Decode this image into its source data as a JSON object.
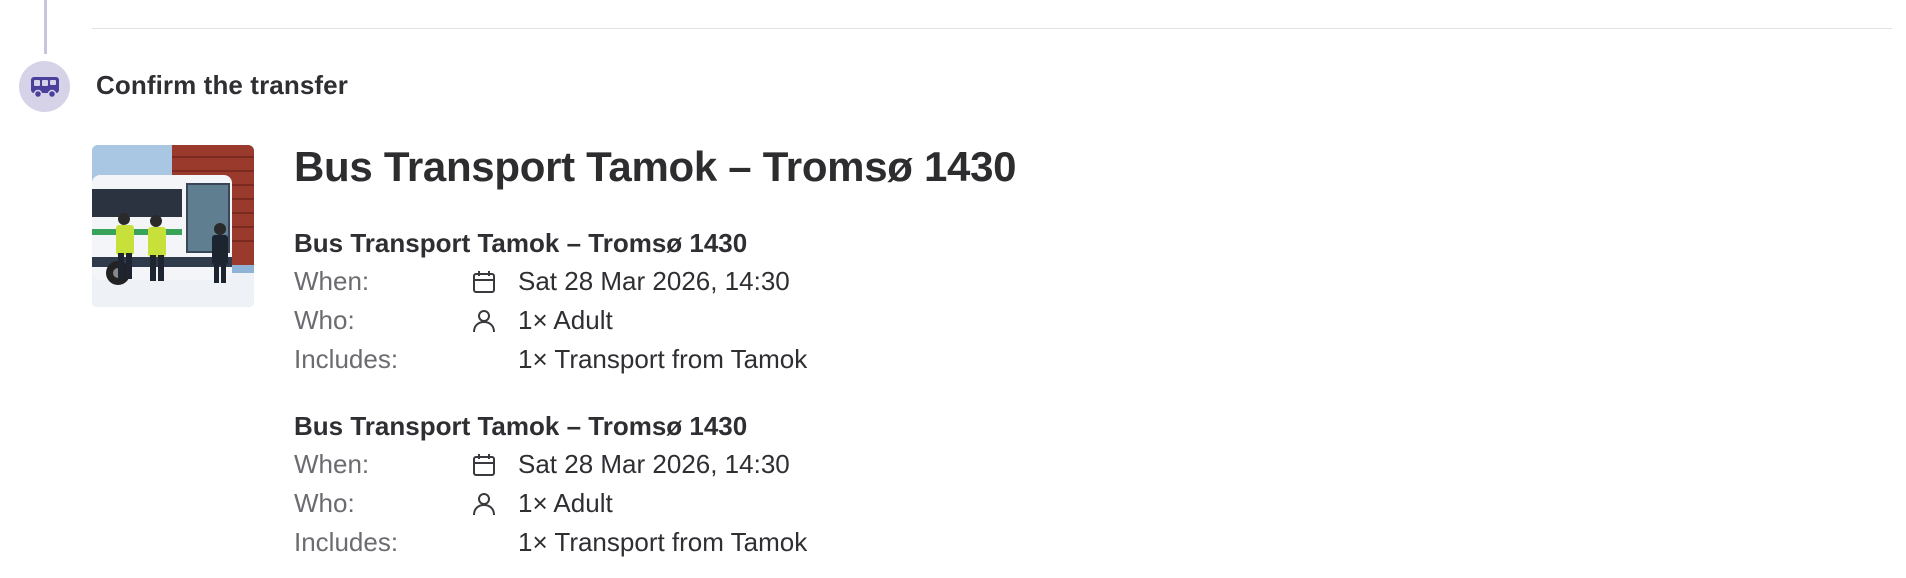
{
  "step": {
    "icon": "bus-icon",
    "title": "Confirm the transfer",
    "badge_color": "#d6d3e8",
    "icon_color": "#4a3f9b"
  },
  "product": {
    "image": "bus-photo",
    "title": "Bus Transport Tamok – Tromsø 1430"
  },
  "bookings": [
    {
      "title": "Bus Transport Tamok – Tromsø 1430",
      "when_label": "When:",
      "when_icon": "calendar-icon",
      "when_value": "Sat 28 Mar 2026, 14:30",
      "who_label": "Who:",
      "who_icon": "person-icon",
      "who_value": "1× Adult",
      "includes_label": "Includes:",
      "includes_value": "1× Transport from Tamok"
    },
    {
      "title": "Bus Transport Tamok – Tromsø 1430",
      "when_label": "When:",
      "when_icon": "calendar-icon",
      "when_value": "Sat 28 Mar 2026, 14:30",
      "who_label": "Who:",
      "who_icon": "person-icon",
      "who_value": "1× Adult",
      "includes_label": "Includes:",
      "includes_value": "1× Transport from Tamok"
    }
  ]
}
